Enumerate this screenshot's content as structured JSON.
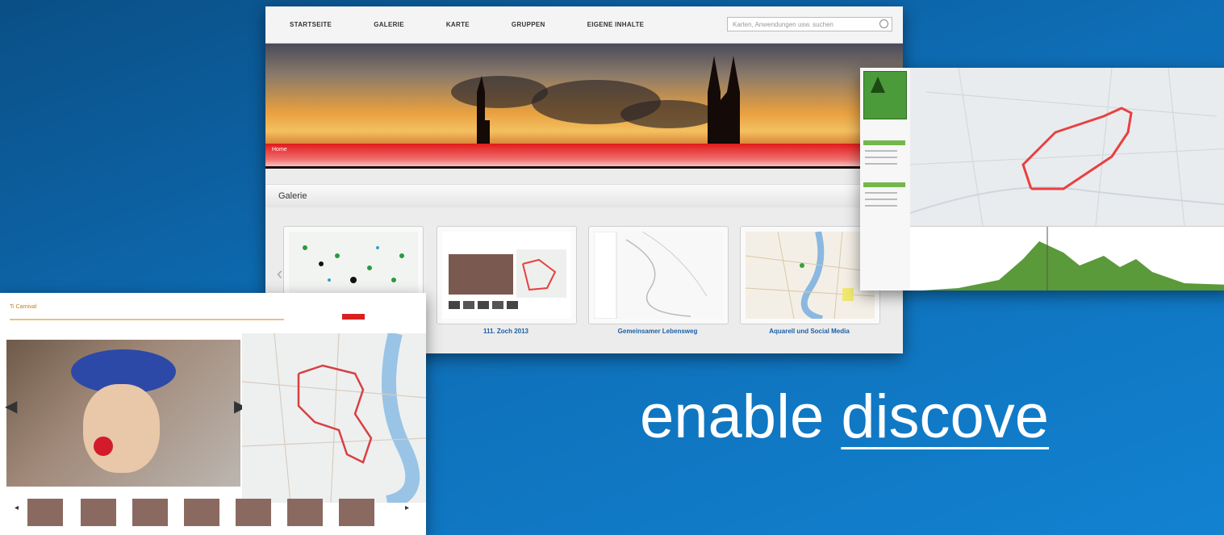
{
  "portal": {
    "nav": [
      {
        "label": "STARTSEITE"
      },
      {
        "label": "GALERIE"
      },
      {
        "label": "KARTE"
      },
      {
        "label": "GRUPPEN"
      },
      {
        "label": "EIGENE INHALTE"
      }
    ],
    "search_placeholder": "Karten, Anwendungen usw. suchen",
    "breadcrumb": "Home",
    "section_title": "Galerie",
    "cards": [
      {
        "label": ""
      },
      {
        "label": "111. Zoch 2013"
      },
      {
        "label": "Gemeinsamer Lebensweg"
      },
      {
        "label": "Aquarell und Social Media"
      }
    ]
  },
  "mapshot": {
    "elevation_line_color": "#5a9a3a",
    "route_color": "#e84040"
  },
  "carnival": {
    "title": "Ti Carnival"
  },
  "tagline": {
    "prefix": "enable ",
    "emphasis": "discove"
  },
  "colors": {
    "accent_red": "#e21a1a",
    "link_blue": "#1b5fa8",
    "background_blue": "#0e6db5"
  }
}
